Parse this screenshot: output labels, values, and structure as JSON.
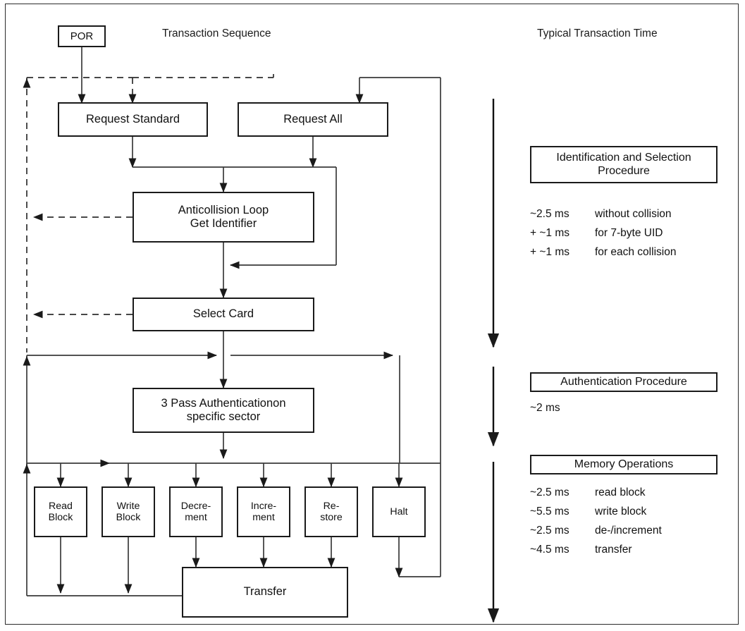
{
  "headers": {
    "left": "Transaction Sequence",
    "right": "Typical Transaction Time"
  },
  "flow_nodes": {
    "por": "POR",
    "request_standard": "Request Standard",
    "request_all": "Request All",
    "anticollision_line1": "Anticollision Loop",
    "anticollision_line2": "Get Identifier",
    "select_card": "Select Card",
    "auth_line1": "3 Pass Authenticationon",
    "auth_line2": "specific sector",
    "read_block_line1": "Read",
    "read_block_line2": "Block",
    "write_block_line1": "Write",
    "write_block_line2": "Block",
    "decrement_line1": "Decre-",
    "decrement_line2": "ment",
    "increment_line1": "Incre-",
    "increment_line2": "ment",
    "restore_line1": "Re-",
    "restore_line2": "store",
    "halt": "Halt",
    "transfer": "Transfer"
  },
  "legends": {
    "identification_line1": "Identification and Selection",
    "identification_line2": "Procedure",
    "authentication": "Authentication Procedure",
    "memory": "Memory Operations"
  },
  "timings": {
    "identification": [
      {
        "amount": "~2.5 ms",
        "description": "without collision"
      },
      {
        "amount": "+ ~1 ms",
        "description": "for 7-byte UID"
      },
      {
        "amount": "+ ~1 ms",
        "description": "for each collision"
      }
    ],
    "authentication": [
      {
        "amount": "~2 ms",
        "description": ""
      }
    ],
    "memory": [
      {
        "amount": "~2.5 ms",
        "description": "read block"
      },
      {
        "amount": "~5.5 ms",
        "description": "write block"
      },
      {
        "amount": "~2.5 ms",
        "description": "de-/increment"
      },
      {
        "amount": "~4.5 ms",
        "description": "transfer"
      }
    ]
  },
  "colors": {
    "stroke": "#1a1a1a",
    "thin_stroke": "#4a4a4a",
    "background": "#ffffff",
    "text": "#111111"
  }
}
